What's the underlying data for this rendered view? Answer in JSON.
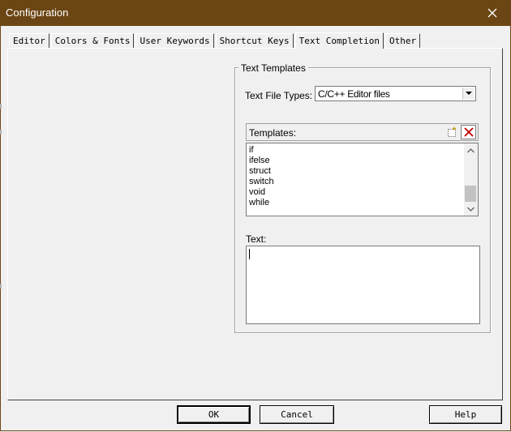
{
  "window": {
    "title": "Configuration"
  },
  "tabs": [
    {
      "label": "Editor"
    },
    {
      "label": "Colors & Fonts"
    },
    {
      "label": "User Keywords"
    },
    {
      "label": "Shortcut Keys"
    },
    {
      "label": "Text Completion",
      "active": true
    },
    {
      "label": "Other"
    }
  ],
  "text_templates": {
    "group_label": "Text Templates",
    "file_types_label": "Text File Types:",
    "file_types_value": "C/C++ Editor files",
    "templates_label": "Templates:",
    "templates": [
      "if",
      "ifelse",
      "struct",
      "switch",
      "void",
      "while"
    ],
    "text_label": "Text:",
    "text_value": ""
  },
  "buttons": {
    "ok": "OK",
    "cancel": "Cancel",
    "help": "Help"
  },
  "icons": {
    "close": "close-icon",
    "dropdown": "chevron-down-icon",
    "new_template": "new-item-icon",
    "delete_template": "delete-x-icon",
    "scroll_up": "chevron-up-icon",
    "scroll_down": "chevron-down-icon"
  },
  "colors": {
    "titlebar": "#6b4513",
    "delete_icon": "#c00000"
  }
}
